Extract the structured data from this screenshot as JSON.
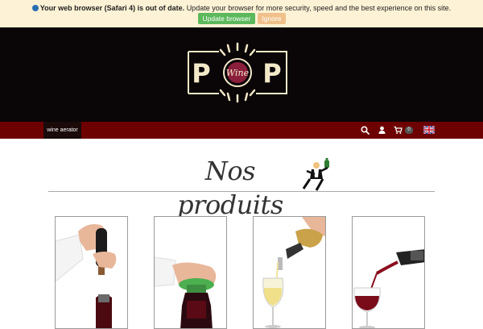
{
  "banner": {
    "bold_text": "Your web browser (Safari 4) is out of date.",
    "text": "Update your browser for more security, speed and the best experience on this site.",
    "update_label": "Update browser",
    "ignore_label": "Ignore"
  },
  "header": {
    "logo_left_letter": "P",
    "logo_right_letter": "P",
    "logo_center_word": "Wine"
  },
  "nav": {
    "active_item": "wine aerator",
    "cart_count": "0",
    "icons": [
      "search-icon",
      "user-icon",
      "cart-icon",
      "uk-flag-icon"
    ]
  },
  "section": {
    "title": "Nos produits"
  },
  "products": [
    {
      "image": "hand-with-corkscrew-over-bottle"
    },
    {
      "image": "hand-with-green-stopper-on-bottle"
    },
    {
      "image": "aerator-pouring-white-wine"
    },
    {
      "image": "aerator-pouring-red-wine"
    }
  ],
  "colors": {
    "banner_bg": "#fdf2d5",
    "header_bg": "#0a0506",
    "nav_bg": "#6d0000",
    "update_button": "#5cb85c",
    "ignore_button": "#f0c08a"
  }
}
